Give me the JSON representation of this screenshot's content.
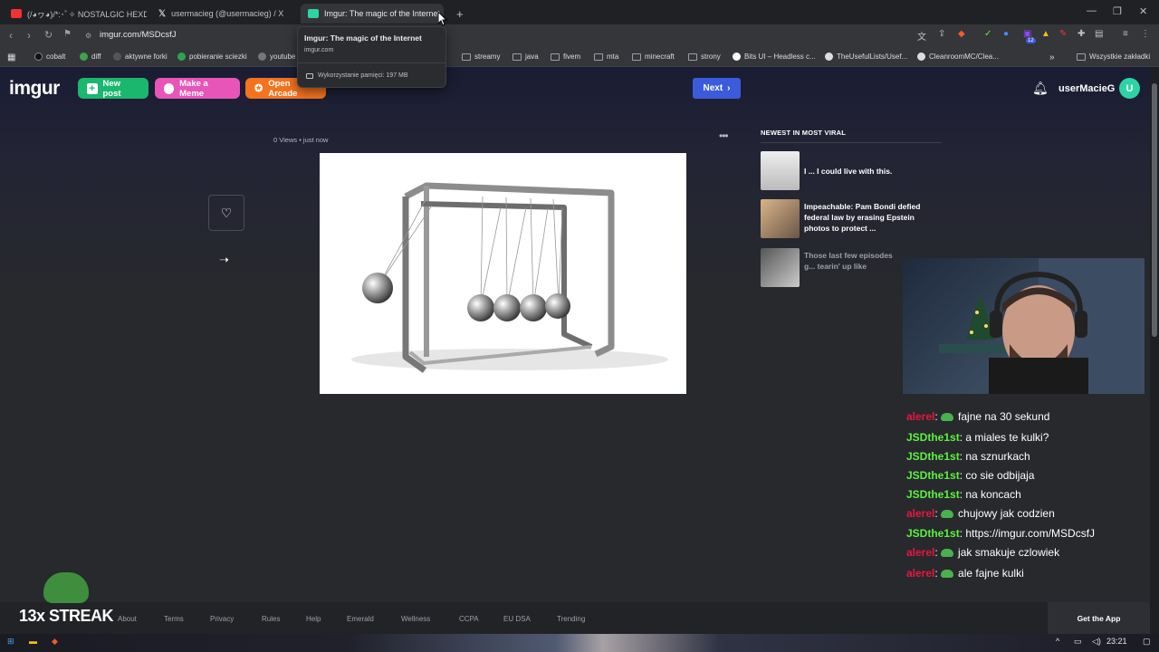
{
  "browser": {
    "tabs": [
      {
        "title": "(/◕ヮ◕)/*:･ﾟ✧ NOSTALGIC HEXD",
        "favicon_color": "#e33"
      },
      {
        "title": "usermacieg (@usermacieg) / X",
        "favicon_color": "#fff"
      },
      {
        "title": "Imgur: The magic of the Internet",
        "favicon_color": "#2ed3a5"
      }
    ],
    "new_tab": "+",
    "url": "imgur.com/MSDcsfJ",
    "bookmarks": [
      "cobalt",
      "diff",
      "aktywne forki",
      "pobieranie sciezki",
      "youtube",
      "x",
      "streamy",
      "java",
      "fivem",
      "mta",
      "minecraft",
      "strony",
      "Bits UI – Headless c...",
      "TheUsefulLists/Usef...",
      "CleanroomMC/Clea..."
    ],
    "all_bookmarks": "Wszystkie zakładki",
    "ext_badge": "12",
    "tooltip": {
      "title": "Imgur: The magic of the Internet",
      "domain": "imgur.com",
      "memory": "Wykorzystanie pamięci: 197 MB"
    }
  },
  "imgur": {
    "logo": "imgur",
    "buttons": {
      "new_post": "New post",
      "make_meme": "Make a Meme",
      "open_arcade": "Open Arcade",
      "next": "Next"
    },
    "username": "userMacieG",
    "avatar_letter": "U",
    "post_meta": "0 Views • just now",
    "sidebar_heading": "NEWEST IN MOST VIRAL",
    "sidebar_items": [
      {
        "title": "I ... I could live with this."
      },
      {
        "title": "Impeachable: Pam Bondi defied federal law by erasing Epstein photos to protect ..."
      },
      {
        "title": "Those last few episodes g... tearin' up like"
      }
    ],
    "footer": [
      "About",
      "Terms",
      "Privacy",
      "Rules",
      "Help",
      "Emerald",
      "Wellness",
      "CCPA",
      "EU DSA",
      "Trending"
    ],
    "get_app": "Get the App"
  },
  "stream": {
    "streak": "13x STREAK",
    "chat": [
      {
        "user": "alerel",
        "color": "#e8173e",
        "emote": true,
        "text": "fajne na 30 sekund"
      },
      {
        "user": "JSDthe1st",
        "color": "#5cf23c",
        "emote": false,
        "text": "a miales te kulki?"
      },
      {
        "user": "JSDthe1st",
        "color": "#5cf23c",
        "emote": false,
        "text": "na sznurkach"
      },
      {
        "user": "JSDthe1st",
        "color": "#5cf23c",
        "emote": false,
        "text": "co sie odbijaja"
      },
      {
        "user": "JSDthe1st",
        "color": "#5cf23c",
        "emote": false,
        "text": "na koncach"
      },
      {
        "user": "alerel",
        "color": "#e8173e",
        "emote": true,
        "text": "chujowy jak codzien"
      },
      {
        "user": "JSDthe1st",
        "color": "#5cf23c",
        "emote": false,
        "text": "https://imgur.com/MSDcsfJ"
      },
      {
        "user": "alerel",
        "color": "#e8173e",
        "emote": true,
        "text": "jak smakuje czlowiek"
      },
      {
        "user": "alerel",
        "color": "#e8173e",
        "emote": true,
        "text": "ale fajne kulki"
      }
    ]
  },
  "taskbar": {
    "time": "23:21"
  },
  "colors": {
    "new_post": "#1bb76e",
    "make_meme": "#e855b8",
    "open_arcade": "#f4731f",
    "next": "#3b5bdb"
  }
}
